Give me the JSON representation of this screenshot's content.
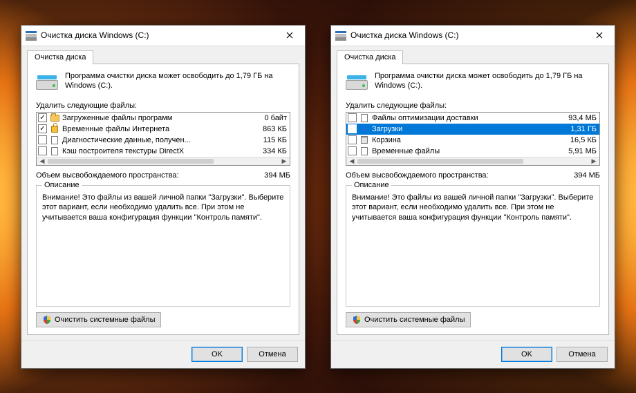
{
  "dialogs": [
    {
      "title": "Очистка диска Windows (C:)",
      "tab_label": "Очистка диска",
      "summary": "Программа очистки диска может освободить до 1,79 ГБ на Windows (C:).",
      "delete_label": "Удалить следующие файлы:",
      "items": [
        {
          "name": "Загруженные файлы программ",
          "size": "0 байт",
          "checked": true,
          "selected": false,
          "icon": "folder"
        },
        {
          "name": "Временные файлы Интернета",
          "size": "863 КБ",
          "checked": true,
          "selected": false,
          "icon": "lock"
        },
        {
          "name": "Диагностические данные, получен...",
          "size": "115 КБ",
          "checked": false,
          "selected": false,
          "icon": "page"
        },
        {
          "name": "Кэш построителя текстуры DirectX",
          "size": "334 КБ",
          "checked": false,
          "selected": false,
          "icon": "page"
        }
      ],
      "freed_label": "Объем высвобождаемого пространства:",
      "freed_value": "394 МБ",
      "description_legend": "Описание",
      "description_text": "Внимание! Это файлы из вашей личной папки \"Загрузки\". Выберите этот вариант, если необходимо удалить все. При этом не учитывается ваша конфигурация функции \"Контроль памяти\".",
      "sysfiles_btn": "Очистить системные файлы",
      "ok": "OK",
      "cancel": "Отмена"
    },
    {
      "title": "Очистка диска Windows (C:)",
      "tab_label": "Очистка диска",
      "summary": "Программа очистки диска может освободить до 1,79 ГБ на Windows (C:).",
      "delete_label": "Удалить следующие файлы:",
      "items": [
        {
          "name": "Файлы оптимизации доставки",
          "size": "93,4 МБ",
          "checked": false,
          "selected": false,
          "icon": "page"
        },
        {
          "name": "Загрузки",
          "size": "1,31 ГБ",
          "checked": false,
          "selected": true,
          "icon": "arrow"
        },
        {
          "name": "Корзина",
          "size": "16,5 КБ",
          "checked": false,
          "selected": false,
          "icon": "bin"
        },
        {
          "name": "Временные файлы",
          "size": "5,91 МБ",
          "checked": false,
          "selected": false,
          "icon": "page"
        }
      ],
      "freed_label": "Объем высвобождаемого пространства:",
      "freed_value": "394 МБ",
      "description_legend": "Описание",
      "description_text": "Внимание! Это файлы из вашей личной папки \"Загрузки\". Выберите этот вариант, если необходимо удалить все. При этом не учитывается ваша конфигурация функции \"Контроль памяти\".",
      "sysfiles_btn": "Очистить системные файлы",
      "ok": "OK",
      "cancel": "Отмена"
    }
  ]
}
